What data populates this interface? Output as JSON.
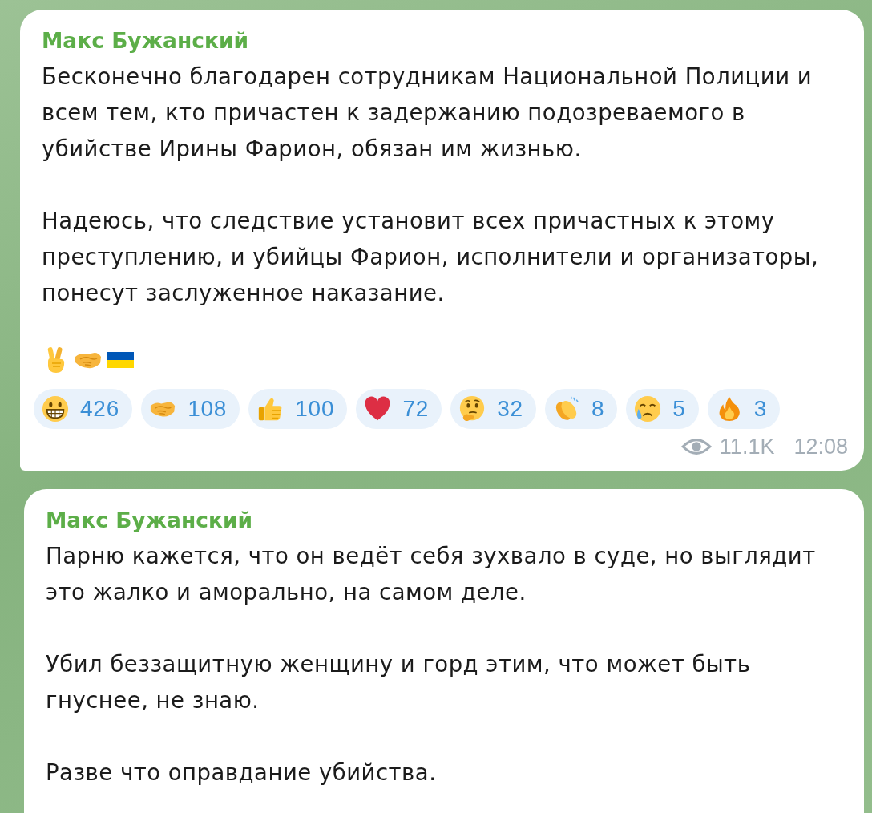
{
  "messages": [
    {
      "sender": "Макс Бужанский",
      "paragraphs": [
        "Бесконечно благодарен сотрудникам Национальной Полиции и всем тем, кто причастен к задержанию подозреваемого в убийстве Ирины Фарион, обязан им жизнью.",
        "Надеюсь, что следствие установит всех причастных к этому преступлению, и убийцы Фарион, исполнители и организаторы, понесут заслуженное наказание."
      ],
      "emojis": [
        {
          "kind": "victory"
        },
        {
          "kind": "handshake"
        },
        {
          "kind": "flag"
        }
      ],
      "reactions": [
        {
          "kind": "grin",
          "count": "426"
        },
        {
          "kind": "handshake",
          "count": "108"
        },
        {
          "kind": "thumbs_up",
          "count": "100"
        },
        {
          "kind": "heart",
          "count": "72"
        },
        {
          "kind": "thinking",
          "count": "32"
        },
        {
          "kind": "clap",
          "count": "8"
        },
        {
          "kind": "crying",
          "count": "5"
        },
        {
          "kind": "fire",
          "count": "3"
        }
      ],
      "views": "11.1K",
      "time": "12:08"
    },
    {
      "sender": "Макс Бужанский",
      "paragraphs": [
        "Парню кажется, что он ведёт себя зухвало в суде, но выглядит это жалко и аморально, на самом деле.",
        "Убил беззащитную женщину и горд этим, что может быть гнуснее, не знаю.",
        "Разве что оправдание убийства."
      ]
    }
  ]
}
